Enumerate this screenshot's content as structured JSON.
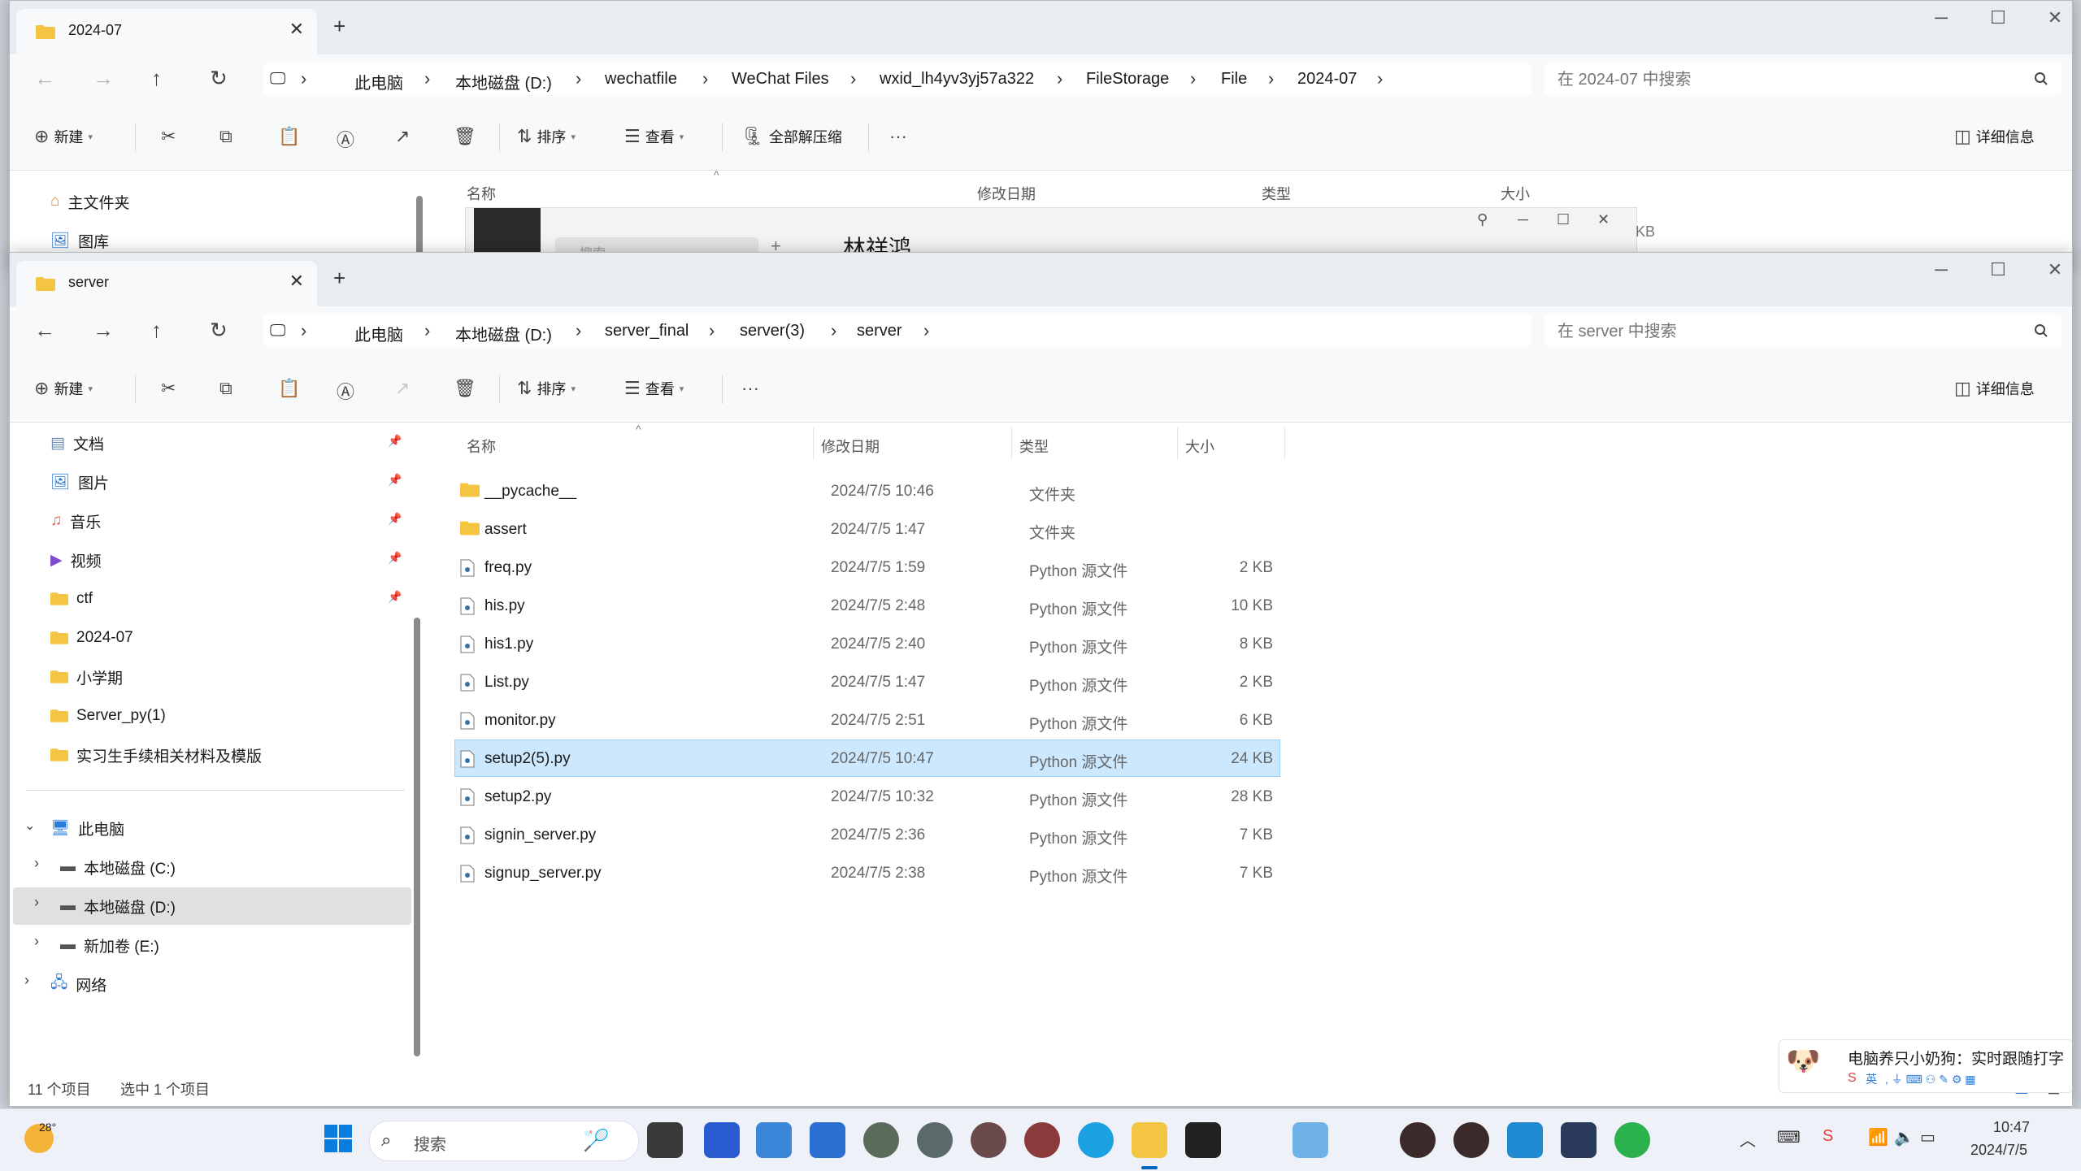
{
  "back_window": {
    "tab_title": "2024-07",
    "breadcrumbs": [
      "此电脑",
      "本地磁盘 (D:)",
      "wechatfile",
      "WeChat Files",
      "wxid_lh4yv3yj57a322",
      "FileStorage",
      "File",
      "2024-07"
    ],
    "search_placeholder": "在 2024-07 中搜索",
    "toolbar": {
      "new": "新建",
      "sort": "排序",
      "view": "查看",
      "compress": "全部解压缩",
      "details": "详细信息"
    },
    "columns": {
      "name": "名称",
      "date": "修改日期",
      "type": "类型",
      "size": "大小"
    },
    "nav": [
      "主文件夹",
      "图库"
    ],
    "overlay_name": "林祥鸿",
    "overlay_search": "搜索",
    "overlay_kb": "KB"
  },
  "front_window": {
    "tab_title": "server",
    "breadcrumbs": [
      "此电脑",
      "本地磁盘 (D:)",
      "server_final",
      "server(3)",
      "server"
    ],
    "search_placeholder": "在 server 中搜索",
    "toolbar": {
      "new": "新建",
      "sort": "排序",
      "view": "查看",
      "details": "详细信息"
    },
    "nav_quick": [
      {
        "label": "文档",
        "pinned": true
      },
      {
        "label": "图片",
        "pinned": true
      },
      {
        "label": "音乐",
        "pinned": true
      },
      {
        "label": "视频",
        "pinned": true
      },
      {
        "label": "ctf",
        "pinned": true
      },
      {
        "label": "2024-07",
        "pinned": false
      },
      {
        "label": "小学期",
        "pinned": false
      },
      {
        "label": "Server_py(1)",
        "pinned": false
      },
      {
        "label": "实习生手续相关材料及模版",
        "pinned": false
      }
    ],
    "nav_pc": {
      "label": "此电脑",
      "drives": [
        "本地磁盘 (C:)",
        "本地磁盘 (D:)",
        "新加卷 (E:)"
      ],
      "network": "网络"
    },
    "columns": {
      "name": "名称",
      "date": "修改日期",
      "type": "类型",
      "size": "大小"
    },
    "files": [
      {
        "name": "__pycache__",
        "date": "2024/7/5 10:46",
        "type": "文件夹",
        "size": "",
        "kind": "folder"
      },
      {
        "name": "assert",
        "date": "2024/7/5 1:47",
        "type": "文件夹",
        "size": "",
        "kind": "folder"
      },
      {
        "name": "freq.py",
        "date": "2024/7/5 1:59",
        "type": "Python 源文件",
        "size": "2 KB",
        "kind": "file"
      },
      {
        "name": "his.py",
        "date": "2024/7/5 2:48",
        "type": "Python 源文件",
        "size": "10 KB",
        "kind": "file"
      },
      {
        "name": "his1.py",
        "date": "2024/7/5 2:40",
        "type": "Python 源文件",
        "size": "8 KB",
        "kind": "file"
      },
      {
        "name": "List.py",
        "date": "2024/7/5 1:47",
        "type": "Python 源文件",
        "size": "2 KB",
        "kind": "file"
      },
      {
        "name": "monitor.py",
        "date": "2024/7/5 2:51",
        "type": "Python 源文件",
        "size": "6 KB",
        "kind": "file"
      },
      {
        "name": "setup2(5).py",
        "date": "2024/7/5 10:47",
        "type": "Python 源文件",
        "size": "24 KB",
        "kind": "file",
        "selected": true
      },
      {
        "name": "setup2.py",
        "date": "2024/7/5 10:32",
        "type": "Python 源文件",
        "size": "28 KB",
        "kind": "file"
      },
      {
        "name": "signin_server.py",
        "date": "2024/7/5 2:36",
        "type": "Python 源文件",
        "size": "7 KB",
        "kind": "file"
      },
      {
        "name": "signup_server.py",
        "date": "2024/7/5 2:38",
        "type": "Python 源文件",
        "size": "7 KB",
        "kind": "file"
      }
    ],
    "status": {
      "count": "11 个项目",
      "selected": "选中 1 个项目"
    }
  },
  "notification": {
    "text": "电脑养只小奶狗：实时跟随打字"
  },
  "taskbar": {
    "weather_temp": "28°",
    "search_placeholder": "搜索",
    "time": "10:47",
    "date": "2024/7/5",
    "ime": "英"
  },
  "colors": {
    "selection": "#cce8ff",
    "folder": "#f4c542",
    "accent": "#0067c0"
  }
}
